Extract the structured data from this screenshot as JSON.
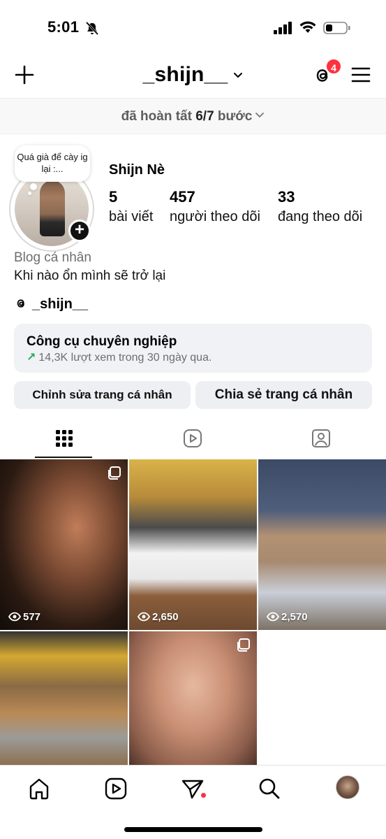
{
  "status_bar": {
    "time": "5:01",
    "icons": [
      "bell-slash-icon",
      "cellular-signal-icon",
      "wifi-icon",
      "battery-icon"
    ]
  },
  "header": {
    "username": "_shijn__",
    "threads_badge_count": "4",
    "icons": [
      "plus-icon",
      "chevron-down-icon",
      "threads-icon",
      "hamburger-menu-icon"
    ]
  },
  "steps": {
    "prefix": "đã hoàn tất ",
    "progress": "6/7",
    "suffix": " bước"
  },
  "profile": {
    "note": "Quá già để cày ig lại :...",
    "display_name": "Shijn Nè",
    "stats": [
      {
        "value": "5",
        "label": "bài viết"
      },
      {
        "value": "457",
        "label": "người theo dõi"
      },
      {
        "value": "33",
        "label": "đang theo dõi"
      }
    ],
    "category": "Blog cá nhân",
    "bio": "Khi nào ổn mình sẽ trở lại",
    "threads_handle": "_shijn__"
  },
  "pro_tools": {
    "title": "Công cụ chuyên nghiệp",
    "subtitle": "14,3K lượt xem trong 30 ngày qua."
  },
  "buttons": {
    "edit_profile": "Chỉnh sửa trang cá nhân",
    "share_profile": "Chia sẻ trang cá nhân"
  },
  "tabs": [
    {
      "name": "grid",
      "icon": "grid-icon",
      "active": true
    },
    {
      "name": "reels",
      "icon": "reels-icon",
      "active": false
    },
    {
      "name": "tagged",
      "icon": "tagged-person-icon",
      "active": false
    }
  ],
  "posts": [
    {
      "views": "577",
      "multi": true
    },
    {
      "views": "2,650",
      "multi": false
    },
    {
      "views": "2,570",
      "multi": false
    },
    {
      "views": "",
      "multi": false
    },
    {
      "views": "",
      "multi": true
    }
  ],
  "bottom_nav": {
    "icons": [
      "home-icon",
      "reels-icon",
      "send-icon",
      "search-icon",
      "profile-avatar"
    ],
    "send_notification_dot": true
  },
  "colors": {
    "badge": "#ff3040",
    "pro_tools_bg": "#f1f2f5",
    "button_bg": "#eeeff2",
    "trend_arrow": "#2aa45d"
  }
}
